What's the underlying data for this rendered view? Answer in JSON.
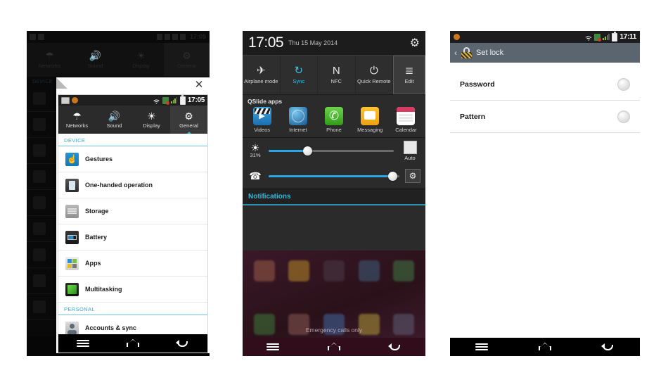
{
  "phone1": {
    "background": {
      "status_time": "17:05",
      "tabs": [
        {
          "label": "Networks",
          "icon": "wifi-icon"
        },
        {
          "label": "Sound",
          "icon": "speaker-icon"
        },
        {
          "label": "Display",
          "icon": "brightness-icon"
        },
        {
          "label": "General",
          "icon": "gear-icon"
        }
      ],
      "section": "DEVICE"
    },
    "window": {
      "close_label": "✕",
      "status_time": "17:05",
      "tabs": [
        {
          "label": "Networks",
          "icon": "wifi-icon",
          "active": false
        },
        {
          "label": "Sound",
          "icon": "speaker-icon",
          "active": false
        },
        {
          "label": "Display",
          "icon": "brightness-icon",
          "active": false
        },
        {
          "label": "General",
          "icon": "gear-icon",
          "active": true
        }
      ],
      "sections": [
        {
          "title": "DEVICE",
          "items": [
            {
              "label": "Gestures",
              "icon": "gestures-icon"
            },
            {
              "label": "One-handed operation",
              "icon": "one-handed-icon"
            },
            {
              "label": "Storage",
              "icon": "storage-icon"
            },
            {
              "label": "Battery",
              "icon": "battery-icon"
            },
            {
              "label": "Apps",
              "icon": "apps-icon"
            },
            {
              "label": "Multitasking",
              "icon": "multitasking-icon"
            }
          ]
        },
        {
          "title": "PERSONAL",
          "items": [
            {
              "label": "Accounts & sync",
              "icon": "accounts-icon"
            }
          ]
        }
      ]
    },
    "navbar": {
      "menu": "menu-icon",
      "home": "home-icon",
      "back": "back-icon"
    }
  },
  "phone2": {
    "header": {
      "clock": "17:05",
      "date": "Thu 15 May 2014",
      "settings_icon": "gear-icon"
    },
    "toggles": [
      {
        "label": "Airplane mode",
        "icon": "airplane-icon",
        "state": "off"
      },
      {
        "label": "Sync",
        "icon": "sync-icon",
        "state": "on"
      },
      {
        "label": "NFC",
        "icon": "nfc-icon",
        "state": "off"
      },
      {
        "label": "Quick Remote",
        "icon": "power-remote-icon",
        "state": "off"
      },
      {
        "label": "Edit",
        "icon": "edit-list-icon",
        "state": "button"
      }
    ],
    "qslide": {
      "title": "QSlide apps",
      "apps": [
        {
          "label": "Videos",
          "icon": "videos-icon"
        },
        {
          "label": "Internet",
          "icon": "browser-icon"
        },
        {
          "label": "Phone",
          "icon": "phone-icon"
        },
        {
          "label": "Messaging",
          "icon": "messaging-icon"
        },
        {
          "label": "Calendar",
          "icon": "calendar-icon"
        }
      ]
    },
    "brightness": {
      "icon": "brightness-icon",
      "value_label": "31%",
      "value": 31,
      "auto_label": "Auto",
      "auto_checked": false
    },
    "volume": {
      "icon": "ringer-volume-icon",
      "value": 95,
      "settings_icon": "gear-icon"
    },
    "notifications_title": "Notifications",
    "home_status": "Emergency calls only",
    "navbar": {
      "menu": "menu-icon",
      "home": "home-icon",
      "back": "back-icon"
    }
  },
  "phone3": {
    "statusbar": {
      "time": "17:11",
      "icons": [
        "bug-icon",
        "wifi-icon",
        "sync-icon",
        "signal-icon",
        "battery-icon"
      ]
    },
    "header": {
      "back_icon": "back-chevron-icon",
      "lock_icon": "padlock-icon",
      "title": "Set lock"
    },
    "options": [
      {
        "label": "Password",
        "selected": false
      },
      {
        "label": "Pattern",
        "selected": false
      }
    ],
    "navbar": {
      "menu": "menu-icon",
      "home": "home-icon",
      "back": "back-icon"
    }
  },
  "colors": {
    "accent_blue": "#2aa7e8",
    "accent_cyan": "#35b6d8",
    "header_gray": "#5a6570",
    "dark_panel": "#2b2b2b"
  }
}
